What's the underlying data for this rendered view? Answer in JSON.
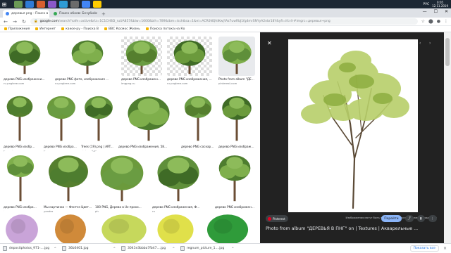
{
  "taskbar": {
    "icon_colors": [
      "#6a9955",
      "#2f7bd6",
      "#d65f2f",
      "#8b58c9",
      "#2f9cd6",
      "#6b6b6b",
      "#4285f4",
      "#ffcc00"
    ],
    "time": "0:05",
    "date": "12.11.2019",
    "lang": "РУС"
  },
  "tabs": [
    {
      "label": "деревья png - Поиск в Google",
      "color": "#4285f4",
      "active": true
    },
    {
      "label": "Поиск обоев: Безубийственный лес",
      "color": "#34a853",
      "active": false
    }
  ],
  "address": {
    "host": "google.com",
    "rest": "/search?safe=active&rlz=1C1CHBD_ruUA857&biw=1600&bih=789&tbm=isch&sa=1&ei=ACR0NQfdKwjYAz7uwRbJ1fg4mrSNYyA2nbr18Y&yfi=ifcr4-#imgrc=деревья+png"
  },
  "bookmarks": [
    "Приложения",
    "Интернет",
    "какое-ру - Поиска В",
    "BBC Космос Жизнь",
    "Поиска потока на Ко"
  ],
  "results": [
    {
      "caption": "дерево PNG изображения, 58.8...",
      "source": "ru.pngtree.com"
    },
    {
      "caption": "дерево PNG фото, изображения ...",
      "source": "ru.pngtree.com"
    },
    {
      "caption": "дерево PNG изображения, 58.8...",
      "source": "imgpng.ru"
    },
    {
      "caption": "дерево PNG изображения, 58.8...",
      "source": "ru.pngtree.com"
    },
    {
      "caption": "Photo from album \"ДЕРЕВЬЯ В ...",
      "source": "pinterest.com"
    },
    {
      "caption": "дерево PNG изображения...",
      "source": "ru.pngtree.com"
    },
    {
      "caption": "дерево PNG изображен...",
      "source": "imgpng.ru"
    },
    {
      "caption": "Trees (19).png | ART...",
      "source": "pinterest.com"
    },
    {
      "caption": "дерево PNG изображения, 58...",
      "source": "ru.pngtree.com"
    },
    {
      "caption": "дерево PNG соскарт ...",
      "source": "clik.ru"
    },
    {
      "caption": "дерево PNG изображен...",
      "source": "ru.pngtree.com"
    },
    {
      "caption": "дерево PNG изображения...",
      "source": "imgpng.ru"
    },
    {
      "caption": "Мы картинки — Фэнтез Цветков...",
      "source": "yandex.ru"
    },
    {
      "caption": "100 PNG, Дерево в Uz прохо...",
      "source": "photoshop-kopona.com"
    },
    {
      "caption": "дерево PNG изображения, Ф...",
      "source": "ru.wirepik.com"
    },
    {
      "caption": "дерево PNG изображения",
      "source": "ru.pngtree.com"
    },
    {
      "caption": "",
      "source": ""
    },
    {
      "caption": "",
      "source": ""
    },
    {
      "caption": "",
      "source": ""
    },
    {
      "caption": "",
      "source": ""
    },
    {
      "caption": "",
      "source": ""
    }
  ],
  "viewer": {
    "title": "Photo from album \"ДЕРЕВЬЯ В ПНГ\" on | Textures | Акварельные ...",
    "badge": "Pinterest",
    "credit": "Изображения могут быть защищены авторским правом. Подробнее",
    "visit_label": "Перейти",
    "close_icon": "close-icon"
  },
  "downloads": [
    {
      "name": "depositphotos_971-....jpg"
    },
    {
      "name": "36b0401.jpg"
    },
    {
      "name": "3041e3bbba7fb47....jpg"
    },
    {
      "name": "regnum_picture_1....jpg"
    }
  ],
  "downloads_show_all": "Показать все",
  "downloads_close": "×"
}
